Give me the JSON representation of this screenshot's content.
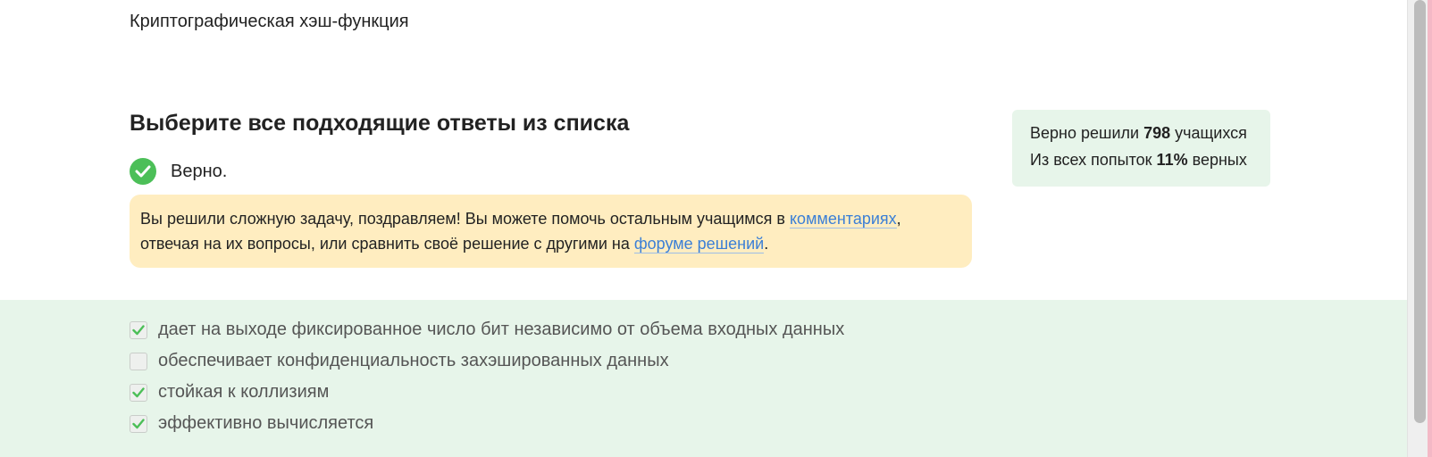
{
  "step": {
    "text": "Криптографическая хэш-функция"
  },
  "question": {
    "title": "Выберите все подходящие ответы из списка"
  },
  "result": {
    "status": "Верно.",
    "status_color": "#4cbf58",
    "message_before_link1": "Вы решили сложную задачу, поздравляем! Вы можете помочь остальным учащимся в ",
    "link1_text": "комментариях",
    "message_middle": ", отвечая на их вопросы, или сравнить своё решение с другими на ",
    "link2_text": "форуме решений",
    "message_after": "."
  },
  "stats": {
    "line1_prefix": "Верно решили ",
    "solved_count": "798",
    "line1_suffix": " учащихся",
    "line2_prefix": "Из всех попыток ",
    "success_rate": "11%",
    "line2_suffix": " верных"
  },
  "options": [
    {
      "label": "дает на выходе фиксированное число бит независимо от объема входных данных",
      "checked": true
    },
    {
      "label": "обеспечивает конфиденциальность захэшированных данных",
      "checked": false
    },
    {
      "label": "стойкая к коллизиям",
      "checked": true
    },
    {
      "label": "эффективно вычисляется",
      "checked": true
    }
  ],
  "colors": {
    "success_green": "#4cbf58",
    "answers_bg": "#e7f5ea",
    "notice_bg": "#ffedc0",
    "link_blue": "#3b7fd6"
  }
}
